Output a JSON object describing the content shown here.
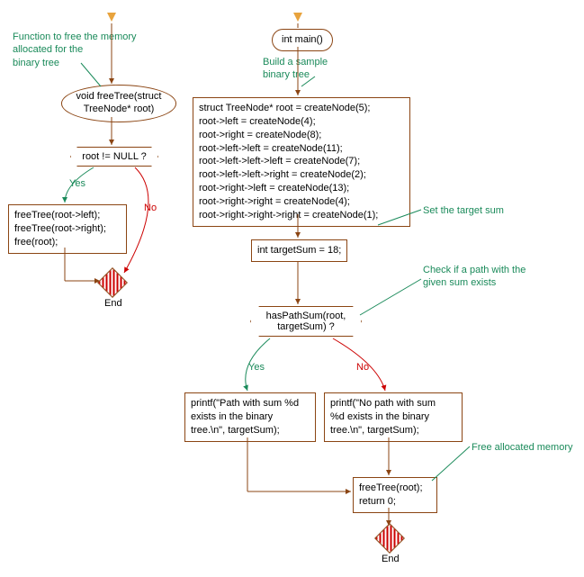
{
  "left": {
    "annot_free": "Function to free the memory\nallocated for the\nbinary tree",
    "freeTree_sig": "void freeTree(struct\nTreeNode* root)",
    "cond": "root != NULL ?",
    "yes": "Yes",
    "no": "No",
    "body": "freeTree(root->left);\nfreeTree(root->right);\nfree(root);",
    "end": "End"
  },
  "right": {
    "main": "int main()",
    "annot_build": "Build a sample\nbinary tree",
    "build_block": "struct TreeNode* root = createNode(5);\nroot->left = createNode(4);\nroot->right = createNode(8);\nroot->left->left = createNode(11);\nroot->left->left->left = createNode(7);\nroot->left->left->right = createNode(2);\nroot->right->left = createNode(13);\nroot->right->right = createNode(4);\nroot->right->right->right = createNode(1);",
    "annot_target": "Set the target sum",
    "target": "int targetSum = 18;",
    "annot_check": "Check if a path with the\ngiven sum exists",
    "cond": "hasPathSum(root,\ntargetSum) ?",
    "yes": "Yes",
    "no": "No",
    "print_yes": "printf(\"Path with sum %d\nexists in the binary\ntree.\\n\", targetSum);",
    "print_no": "printf(\"No path with sum\n%d exists in the binary\ntree.\\n\", targetSum);",
    "annot_free": "Free allocated memory",
    "cleanup": "freeTree(root);\nreturn 0;",
    "end": "End"
  }
}
